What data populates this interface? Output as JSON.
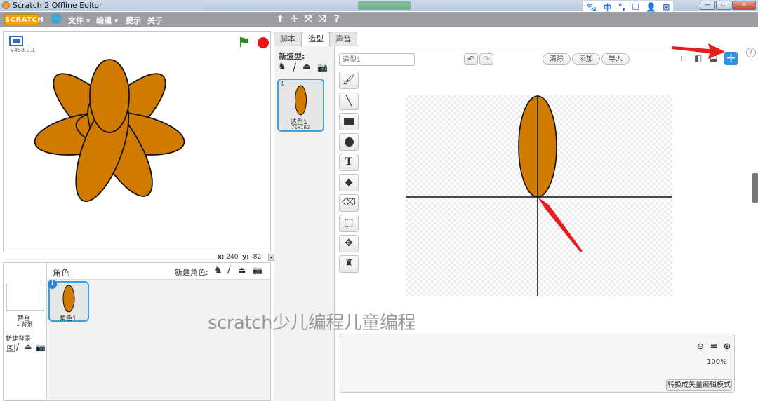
{
  "window": {
    "title": "Scratch 2 Offline Editor",
    "controls": [
      "—",
      "▭",
      "✕"
    ]
  },
  "ime": [
    "🐾",
    "中",
    "°,",
    "☐",
    "👤",
    "⊞"
  ],
  "menubar": {
    "logo": "SCRATCH",
    "items": [
      "文件 ▾",
      "编辑 ▾",
      "提示",
      "关于"
    ],
    "tools": [
      "⬆",
      "✛",
      "⤧",
      "⤨",
      "?"
    ]
  },
  "stage": {
    "version": "v458.0.1",
    "coords": {
      "x_label": "x:",
      "x": "240",
      "y_label": "y:",
      "y": "-82"
    }
  },
  "sprites": {
    "header": "角色",
    "new_sprite_label": "新建角色:",
    "stage_name": "舞台",
    "stage_backdrops": "1 背景",
    "new_backdrop_label": "新建背景",
    "sprite_name": "角色1",
    "info_badge": "i"
  },
  "tabs": [
    "脚本",
    "造型",
    "声音"
  ],
  "costume_editor": {
    "new_costume_label": "新造型:",
    "costume_index": "1",
    "costume_name": "造型1",
    "costume_size": "71x182",
    "name_field_placeholder": "造型1",
    "clear_label": "清除",
    "add_label": "添加",
    "import_label": "导入",
    "zoom_percent": "100%",
    "convert_label": "转换成矢量编辑模式",
    "watermark": "scratch少儿编程儿童编程"
  },
  "colors": {
    "costume_fill": "#d17a00",
    "selection_blue": "#33a3e4",
    "stop_red": "#e8131b",
    "flag_green": "#2b8a24",
    "annotation_red": "#e41f1f"
  }
}
